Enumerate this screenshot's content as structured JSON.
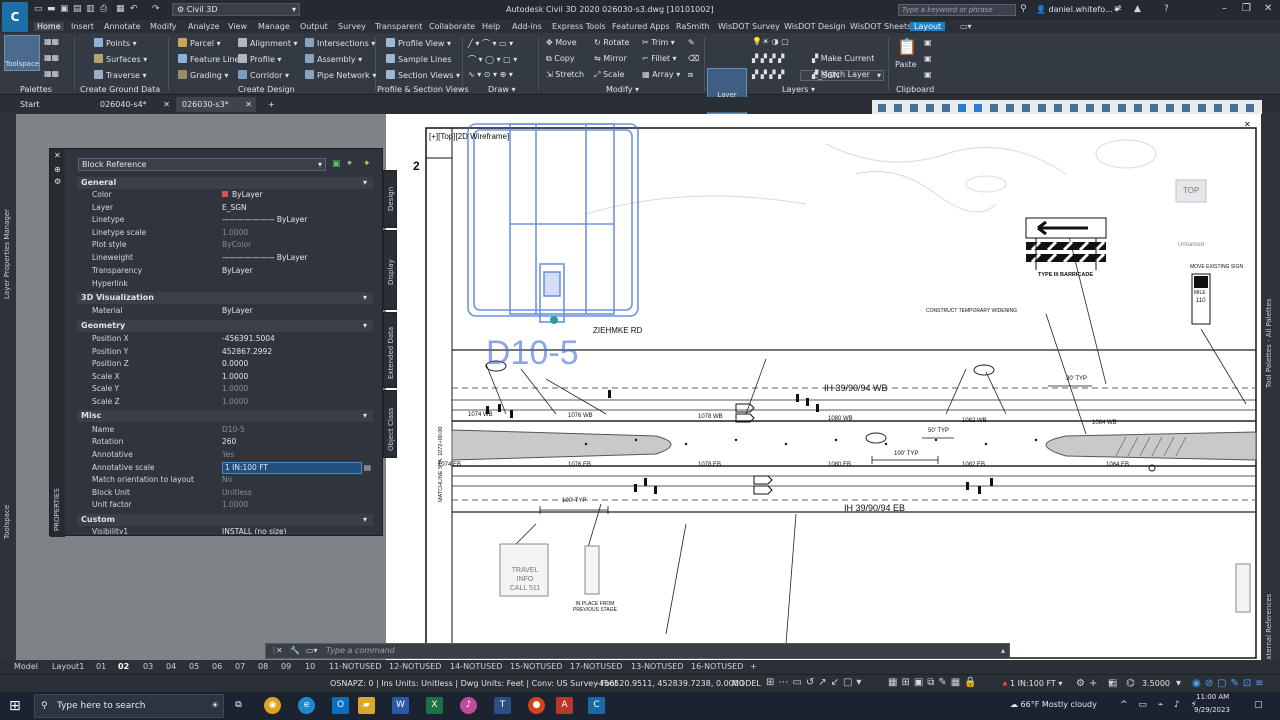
{
  "window": {
    "title": "Autodesk Civil 3D 2020    026030-s3.dwg [10101002]",
    "workspace": "Civil 3D",
    "search_placeholder": "Type a keyword or phrase",
    "user": "daniel.whitefo..."
  },
  "menu_tabs": [
    "Home",
    "Insert",
    "Annotate",
    "Modify",
    "Analyze",
    "View",
    "Manage",
    "Output",
    "Survey",
    "Transparent",
    "Collaborate",
    "Help",
    "Add-ins",
    "Express Tools",
    "Featured Apps",
    "RaSmith",
    "WisDOT Survey",
    "WisDOT Design",
    "WisDOT Sheets",
    "Layout"
  ],
  "ribbon": {
    "toolspace": "Toolspace",
    "palettes": "Palettes",
    "ground": [
      "Points",
      "Surfaces",
      "Traverse"
    ],
    "ground_panel": "Create Ground Data",
    "design1": [
      "Parcel",
      "Feature Line",
      "Grading"
    ],
    "design2": [
      "Alignment",
      "Profile",
      "Corridor"
    ],
    "design3": [
      "Intersections",
      "Assembly",
      "Pipe Network"
    ],
    "design_panel": "Create Design",
    "profile": [
      "Profile View",
      "Sample Lines",
      "Section Views"
    ],
    "profile_panel": "Profile & Section Views",
    "draw_panel": "Draw",
    "modify1": [
      "Move",
      "Copy",
      "Stretch"
    ],
    "modify2": [
      "Rotate",
      "Mirror",
      "Scale"
    ],
    "modify3": [
      "Trim",
      "Fillet",
      "Array"
    ],
    "modify_panel": "Modify",
    "layer_properties": "Layer Properties",
    "layer_current": "E_SGN",
    "layers_tools": [
      "Make Current",
      "Match Layer"
    ],
    "layers_panel": "Layers",
    "paste": "Paste",
    "clipboard_panel": "Clipboard"
  },
  "file_tabs": [
    "Start",
    "026040-s4*",
    "026030-s3*"
  ],
  "viewport_label": "[+][Top][2D Wireframe]",
  "properties": {
    "object_type": "Block Reference",
    "sections": {
      "general": "General",
      "viz": "3D Visualization",
      "geometry": "Geometry",
      "misc": "Misc",
      "custom": "Custom"
    },
    "general": [
      {
        "name": "Color",
        "value": "ByLayer"
      },
      {
        "name": "Layer",
        "value": "E_SGN"
      },
      {
        "name": "Linetype",
        "value": "——————— ByLayer"
      },
      {
        "name": "Linetype scale",
        "value": "1.0000"
      },
      {
        "name": "Plot style",
        "value": "ByColor"
      },
      {
        "name": "Lineweight",
        "value": "——————— ByLayer"
      },
      {
        "name": "Transparency",
        "value": "ByLayer"
      },
      {
        "name": "Hyperlink",
        "value": ""
      }
    ],
    "viz": [
      {
        "name": "Material",
        "value": "ByLayer"
      }
    ],
    "geometry": [
      {
        "name": "Position X",
        "value": "-456391.5004"
      },
      {
        "name": "Position Y",
        "value": "452867.2992"
      },
      {
        "name": "Position Z",
        "value": "0.0000"
      },
      {
        "name": "Scale X",
        "value": "1.0000"
      },
      {
        "name": "Scale Y",
        "value": "1.0000"
      },
      {
        "name": "Scale Z",
        "value": "1.0000"
      }
    ],
    "misc": [
      {
        "name": "Name",
        "value": "D10-5"
      },
      {
        "name": "Rotation",
        "value": "260"
      },
      {
        "name": "Annotative",
        "value": "Yes"
      },
      {
        "name": "Annotative scale",
        "value": "1 IN:100 FT"
      },
      {
        "name": "Match orientation to layout",
        "value": "No"
      },
      {
        "name": "Block Unit",
        "value": "Unitless"
      },
      {
        "name": "Unit factor",
        "value": "1.0000"
      }
    ],
    "custom": [
      {
        "name": "Visibility1",
        "value": "INSTALL (no size)"
      }
    ],
    "side_tabs": [
      "Design",
      "Display",
      "Extended Data",
      "Object Class"
    ]
  },
  "side_labels": {
    "left_top": "Layer Properties Manager",
    "left_bottom": "Toolspace",
    "props": "PROPERTIES",
    "right_top": "Tool Palettes - All Palettes",
    "right_bottom": "External References"
  },
  "drawing": {
    "sheet_number": "2",
    "road_name": "ZIEHMKE RD",
    "block_name": "D10-5",
    "wb_label": "IH 39/90/94 WB",
    "eb_label": "IH 39/90/94 EB",
    "matchline": "MATCHLINE STA. 1072+00.00",
    "barricade": "TYPE III BARRICADE",
    "widening": "CONSTRUCT TEMPORARY WIDENING",
    "move_sign": "MOVE EXISTING SIGN",
    "travel_sign": "TRAVEL INFO CALL 511",
    "in_place": "IN PLACE FROM PREVIOUS STAGE",
    "typ_100": "100' TYP",
    "typ_50": "50' TYP",
    "typ_30": "30' TYP",
    "viewcube": "TOP",
    "unnamed": "Unnamed",
    "mile": "MILE",
    "mile_num": "110",
    "wb_stations": [
      "1074 WB",
      "1076 WB",
      "1078 WB",
      "1080 WB",
      "1082 WB",
      "1084 WB"
    ],
    "eb_stations": [
      "1074 EB",
      "1076 EB",
      "1078 EB",
      "1080 EB",
      "1082 EB",
      "1084 EB"
    ]
  },
  "command_placeholder": "Type a command",
  "layout_tabs": [
    "Model",
    "Layout1",
    "01",
    "02",
    "03",
    "04",
    "05",
    "06",
    "07",
    "08",
    "09",
    "10",
    "11-NOTUSED",
    "12-NOTUSED",
    "14-NOTUSED",
    "15-NOTUSED",
    "17-NOTUSED",
    "13-NOTUSED",
    "16-NOTUSED"
  ],
  "status": {
    "info": "OSNAPZ: 0 | Ins Units: Unitless | Dwg Units: Feet | Conv: US Survey Foot",
    "coords": "-456520.9511, 452839.7238, 0.0000",
    "mode": "MODEL",
    "scale": "1 IN:100 FT",
    "value": "3.5000"
  },
  "taskbar": {
    "search_placeholder": "Type here to search",
    "weather": "66°F  Mostly cloudy",
    "time": "11:00 AM",
    "date": "9/29/2023"
  }
}
